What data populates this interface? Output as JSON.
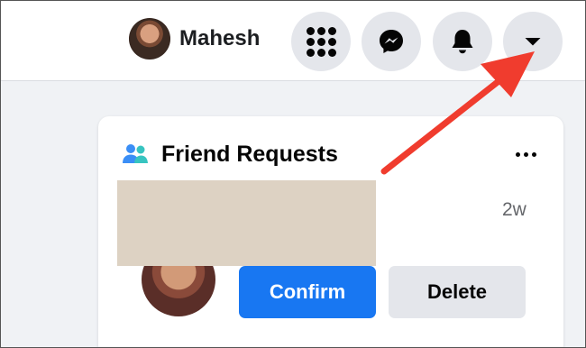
{
  "header": {
    "user_name": "Mahesh",
    "icons": [
      "menu-grid-icon",
      "messenger-icon",
      "bell-icon",
      "caret-down-icon"
    ]
  },
  "friend_requests": {
    "title": "Friend Requests",
    "request": {
      "time_ago": "2w",
      "confirm_label": "Confirm",
      "delete_label": "Delete"
    }
  },
  "colors": {
    "primary_blue": "#1877f2",
    "annotation_red": "#f03c2e",
    "icon_gray_bg": "#e4e6eb"
  }
}
